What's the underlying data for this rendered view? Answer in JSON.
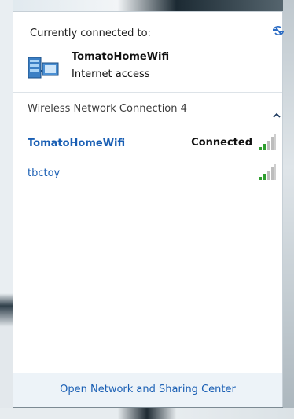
{
  "connected_section": {
    "heading": "Currently connected to:",
    "network_name": "TomatoHomeWifi",
    "network_status": "Internet access"
  },
  "group": {
    "label": "Wireless Network Connection 4",
    "expanded": true
  },
  "networks": [
    {
      "name": "TomatoHomeWifi",
      "status": "Connected",
      "signal_bars": 4
    },
    {
      "name": "tbctoy",
      "status": "",
      "signal_bars": 4
    }
  ],
  "footer": {
    "link_label": "Open Network and Sharing Center"
  },
  "colors": {
    "link_blue": "#1a5fb4",
    "signal_green": "#2f9e2f",
    "signal_gray": "#bdbdbd",
    "footer_bg": "#edf3f8"
  },
  "icons": {
    "refresh": "refresh-icon",
    "network": "network-computer-icon",
    "signal": "wifi-signal-icon",
    "chevron": "chevron-up-icon"
  }
}
